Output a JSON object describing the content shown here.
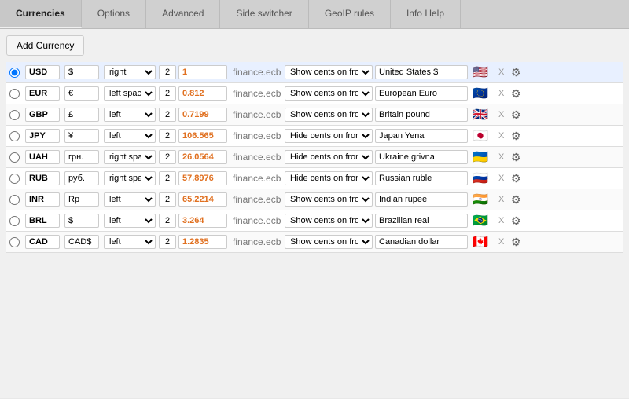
{
  "tabs": [
    {
      "label": "Currencies",
      "active": true
    },
    {
      "label": "Options",
      "active": false
    },
    {
      "label": "Advanced",
      "active": false
    },
    {
      "label": "Side switcher",
      "active": false
    },
    {
      "label": "GeoIP rules",
      "active": false
    },
    {
      "label": "Info Help",
      "active": false
    }
  ],
  "add_button": "Add Currency",
  "currencies": [
    {
      "code": "USD",
      "symbol": "$",
      "position": "right",
      "decimals": "2",
      "rate": "1",
      "source": "finance.ecb",
      "cents": "Show cents on front",
      "name": "United States $",
      "flag": "🇺🇸",
      "selected": true
    },
    {
      "code": "EUR",
      "symbol": "€",
      "position": "left space",
      "decimals": "2",
      "rate": "0.812",
      "source": "finance.ecb",
      "cents": "Show cents on front",
      "name": "European Euro",
      "flag": "🇪🇺",
      "selected": false
    },
    {
      "code": "GBP",
      "symbol": "£",
      "position": "left",
      "decimals": "2",
      "rate": "0.7199",
      "source": "finance.ecb",
      "cents": "Show cents on front",
      "name": "Britain pound",
      "flag": "🇬🇧",
      "selected": false
    },
    {
      "code": "JPY",
      "symbol": "¥",
      "position": "left",
      "decimals": "2",
      "rate": "106.565",
      "source": "finance.ecb",
      "cents": "Hide cents on front",
      "name": "Japan Yena",
      "flag": "🇯🇵",
      "selected": false
    },
    {
      "code": "UAH",
      "symbol": "грн.",
      "position": "right space",
      "decimals": "2",
      "rate": "26.0564",
      "source": "finance.ecb",
      "cents": "Hide cents on front",
      "name": "Ukraine grivna",
      "flag": "🇺🇦",
      "selected": false
    },
    {
      "code": "RUB",
      "symbol": "руб.",
      "position": "right space",
      "decimals": "2",
      "rate": "57.8976",
      "source": "finance.ecb",
      "cents": "Hide cents on front",
      "name": "Russian ruble",
      "flag": "🇷🇺",
      "selected": false
    },
    {
      "code": "INR",
      "symbol": "Rp",
      "position": "left",
      "decimals": "2",
      "rate": "65.2214",
      "source": "finance.ecb",
      "cents": "Show cents on front",
      "name": "Indian rupee",
      "flag": "🇮🇳",
      "selected": false
    },
    {
      "code": "BRL",
      "symbol": "$",
      "position": "left",
      "decimals": "2",
      "rate": "3.264",
      "source": "finance.ecb",
      "cents": "Show cents on front",
      "name": "Brazilian real",
      "flag": "🇧🇷",
      "selected": false
    },
    {
      "code": "CAD",
      "symbol": "CAD$",
      "position": "left",
      "decimals": "2",
      "rate": "1.2835",
      "source": "finance.ecb",
      "cents": "Show cents on front",
      "name": "Canadian dollar",
      "flag": "🇨🇦",
      "selected": false
    }
  ]
}
